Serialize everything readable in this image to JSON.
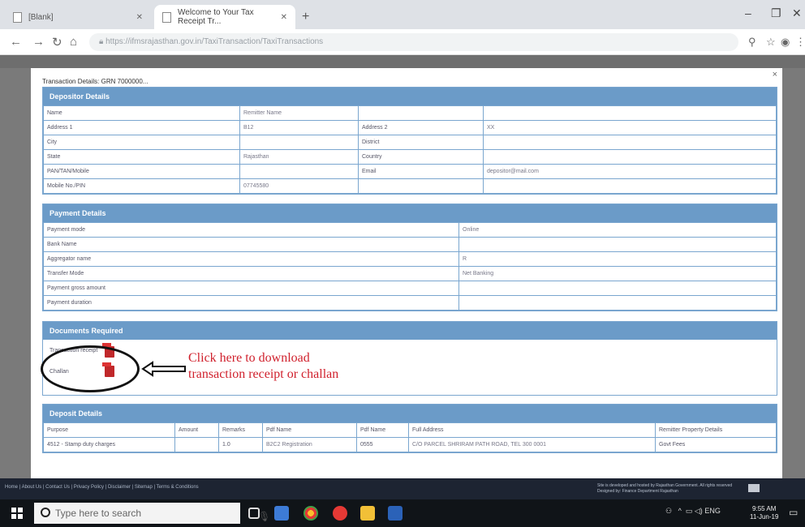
{
  "browser": {
    "tabs": [
      {
        "title": "[Blank]"
      },
      {
        "title": "Welcome to Your Tax Receipt Tr..."
      }
    ],
    "url": "https://ifmsrajasthan.gov.in/TaxiTransaction/TaxiTransactions"
  },
  "modal": {
    "title": "Transaction Details: GRN 7000000...",
    "depositor": {
      "heading": "Depositor Details",
      "rows": [
        [
          "Name",
          "Remitter Name",
          "",
          ""
        ],
        [
          "Address 1",
          "B12",
          "Address 2",
          "XX"
        ],
        [
          "City",
          "",
          "District",
          ""
        ],
        [
          "State",
          "Rajasthan",
          "Country",
          ""
        ],
        [
          "PAN/TAN/Mobile",
          "",
          "Email",
          "depositor@mail.com"
        ],
        [
          "Mobile No./PIN",
          "07745580",
          "",
          ""
        ]
      ]
    },
    "payment": {
      "heading": "Payment Details",
      "rows": [
        [
          "Payment mode",
          "Online"
        ],
        [
          "Bank Name",
          ""
        ],
        [
          "Aggregator name",
          "R"
        ],
        [
          "Transfer Mode",
          "Net Banking"
        ],
        [
          "Payment gross amount",
          ""
        ],
        [
          "Payment duration",
          ""
        ]
      ]
    },
    "documents": {
      "heading": "Documents Required",
      "items": [
        "Transaction receipt",
        "Challan"
      ]
    },
    "annotation": {
      "line1": "Click here to download",
      "line2": "transaction receipt or challan"
    },
    "deposit": {
      "heading": "Deposit Details",
      "headers": [
        "Purpose",
        "Amount",
        "Remarks",
        "Pdf Name",
        "Pdf Name",
        "Full Address",
        "Remitter Property Details"
      ],
      "rows": [
        [
          "4512 - Stamp duty charges",
          "",
          "1.0",
          "B2C2 Registration",
          "0555",
          "C/O PARCEL SHRIRAM PATH ROAD, TEL 300 0001",
          "Govt Fees"
        ]
      ]
    }
  },
  "footer": {
    "links": "Home  |  About Us  |  Contact Us  |  Privacy Policy  |  Disclaimer  |  Sitemap  |  Terms & Conditions",
    "right1": "Site is developed and hosted by Rajasthan Government. All rights reserved",
    "right2": "Designed by: Finance Department Rajasthan"
  },
  "taskbar": {
    "search_placeholder": "Type here to search",
    "lang": "ENG",
    "time": "9:55 AM",
    "date": "11-Jun-19"
  },
  "colors": {
    "panel_header": "#6b9bc8",
    "annotation_text": "#d0202c",
    "pdf_icon": "#c0282a"
  }
}
